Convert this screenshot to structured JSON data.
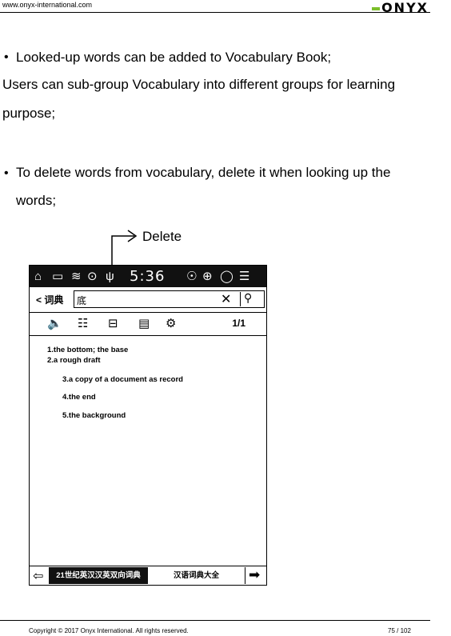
{
  "header": {
    "url": "www.onyx-international.com",
    "logo": "ONYX"
  },
  "content": {
    "bullet1": "Looked-up words can be added to Vocabulary Book;",
    "para1_line1": "Users can sub-group Vocabulary into different groups for learning",
    "para1_line2": "purpose;",
    "bullet2_line1": "To delete words from vocabulary, delete it when looking up the",
    "bullet2_line2": "words;",
    "delete_label": "Delete"
  },
  "device": {
    "time": "5:36",
    "back_label": "词典",
    "search_value": "底",
    "page_indicator": "1/1",
    "definitions": [
      "1.the bottom; the base",
      "2.a rough draft",
      "3.a copy of a document as record",
      "4.the end",
      "5.the background"
    ],
    "dict_tab_active": "21世纪英汉汉英双向词典",
    "dict_tab_other": "汉语词典大全"
  },
  "footer": {
    "copyright": "Copyright © 2017 Onyx International. All rights reserved.",
    "page": "75 / 102"
  }
}
